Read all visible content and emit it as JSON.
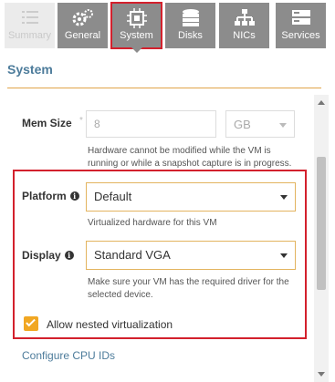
{
  "tabs": [
    {
      "label": "Summary",
      "icon": "summary-icon",
      "state": "disabled"
    },
    {
      "label": "General",
      "icon": "gears-icon",
      "state": "normal"
    },
    {
      "label": "System",
      "icon": "chip-icon",
      "state": "active"
    },
    {
      "label": "Disks",
      "icon": "disks-icon",
      "state": "normal"
    },
    {
      "label": "NICs",
      "icon": "network-icon",
      "state": "normal"
    },
    {
      "label": "Services",
      "icon": "services-icon",
      "state": "normal"
    }
  ],
  "section": {
    "title": "System"
  },
  "mem_size": {
    "label": "Mem Size",
    "required_mark": "*",
    "value": "8",
    "unit": "GB",
    "help": "Hardware cannot be modified while the VM is running or while a snapshot capture is in progress."
  },
  "platform": {
    "label": "Platform",
    "selected": "Default",
    "help": "Virtualized hardware for this VM"
  },
  "display": {
    "label": "Display",
    "selected": "Standard VGA",
    "help": "Make sure your VM has the required driver for the selected device."
  },
  "nested": {
    "label": "Allow nested virtualization",
    "checked": true
  },
  "link": {
    "label": "Configure CPU IDs"
  },
  "colors": {
    "tab_bg": "#8c8c8c",
    "tab_active_outline": "#d3212d",
    "accent": "#e0a44a",
    "link": "#4d7c9b",
    "checkbox": "#f1a722",
    "highlight": "#d3212d"
  }
}
